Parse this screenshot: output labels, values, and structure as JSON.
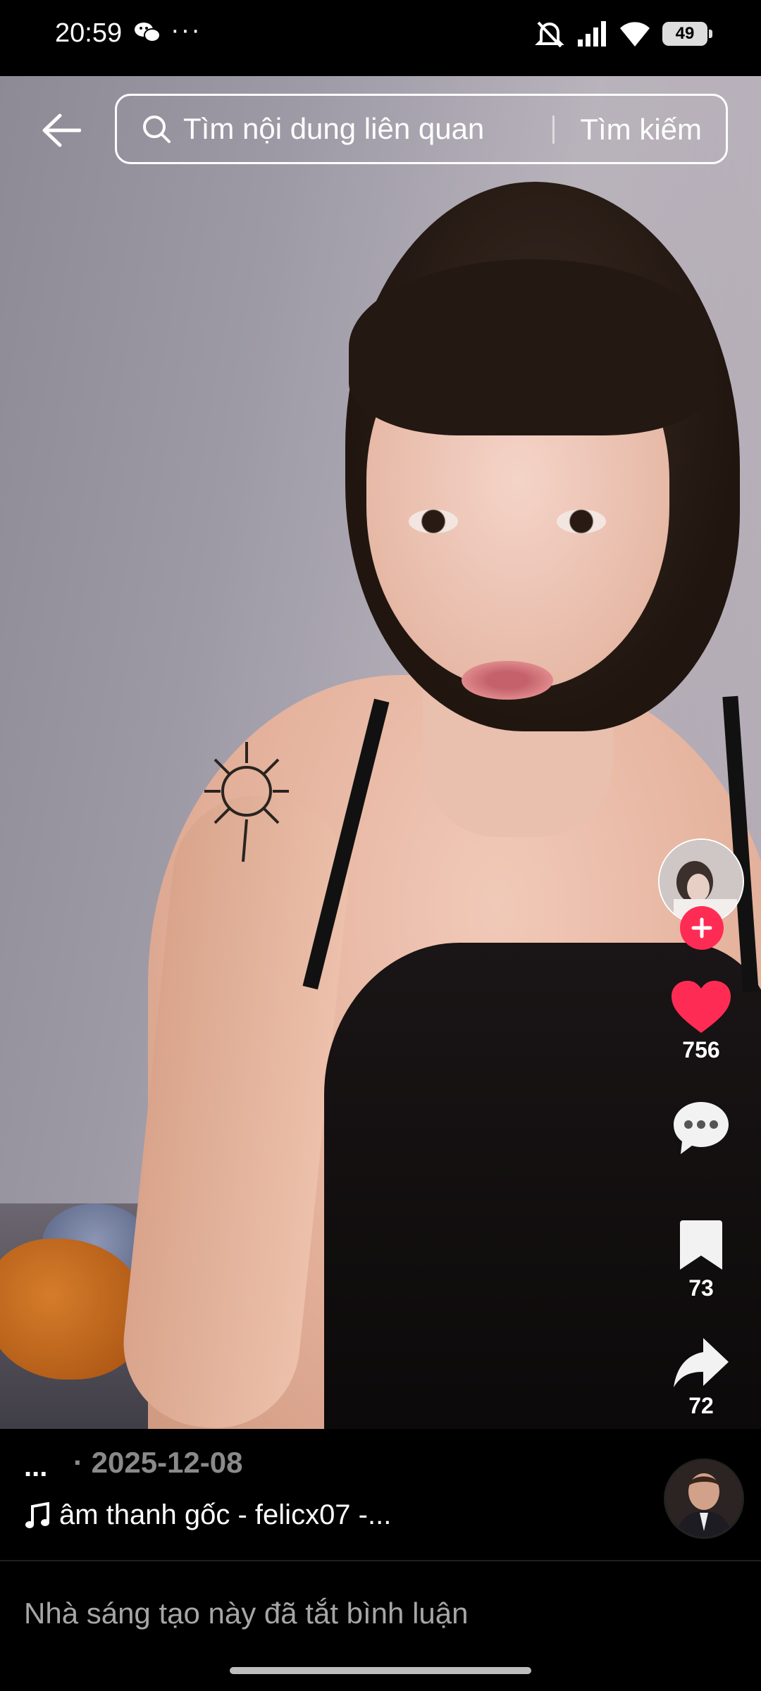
{
  "status_bar": {
    "time": "20:59",
    "more_dots": "···",
    "battery": "49"
  },
  "search": {
    "placeholder": "Tìm nội dung liên quan",
    "button_label": "Tìm kiếm"
  },
  "rail": {
    "likes": "756",
    "bookmarks": "73",
    "shares": "72"
  },
  "info": {
    "more": "...",
    "date": "· 2025-12-08",
    "music": "âm thanh gốc - felicx07 -..."
  },
  "comment_bar": {
    "text": "Nhà sáng tạo này đã tắt bình luận"
  },
  "colors": {
    "accent": "#fe2c55",
    "background": "#000000"
  },
  "icons": [
    "back-arrow-icon",
    "search-icon",
    "plus-icon",
    "heart-icon",
    "comment-icon",
    "bookmark-icon",
    "share-icon",
    "music-note-icon",
    "wechat-icon",
    "mute-icon",
    "signal-icon",
    "wifi-icon",
    "battery-icon"
  ]
}
